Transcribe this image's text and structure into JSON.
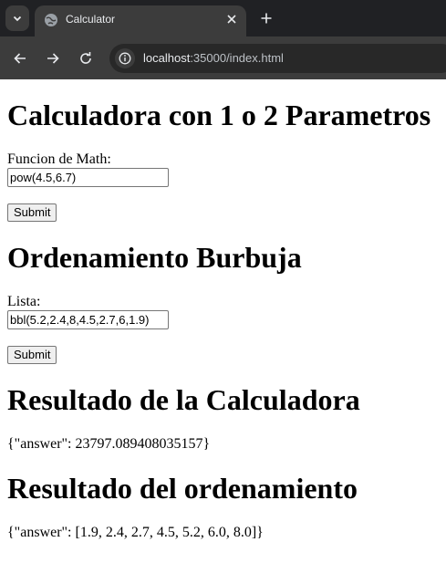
{
  "browser": {
    "tab_title": "Calculator",
    "url_host": "localhost",
    "url_rest": ":35000/index.html"
  },
  "page": {
    "calc_heading": "Calculadora con 1 o 2 Parametros",
    "calc_label": "Funcion de Math:",
    "calc_input_value": "pow(4.5,6.7)",
    "calc_submit": "Submit",
    "sort_heading": "Ordenamiento Burbuja",
    "sort_label": "Lista:",
    "sort_input_value": "bbl(5.2,2.4,8,4.5,2.7,6,1.9)",
    "sort_submit": "Submit",
    "calc_result_heading": "Resultado de la Calculadora",
    "calc_result_text": "{\"answer\": 23797.089408035157}",
    "sort_result_heading": "Resultado del ordenamiento",
    "sort_result_text": "{\"answer\": [1.9, 2.4, 2.7, 4.5, 5.2, 6.0, 8.0]}"
  },
  "icons": {
    "tab_dropdown": "chevron-down-icon",
    "favicon": "globe-icon",
    "tab_close": "close-icon",
    "new_tab": "plus-icon",
    "back": "arrow-left-icon",
    "forward": "arrow-right-icon",
    "reload": "reload-icon",
    "site_info": "info-icon"
  },
  "colors": {
    "chrome_dark": "#202124",
    "chrome_toolbar": "#3c3c3c",
    "chrome_text": "#e8eaed"
  }
}
